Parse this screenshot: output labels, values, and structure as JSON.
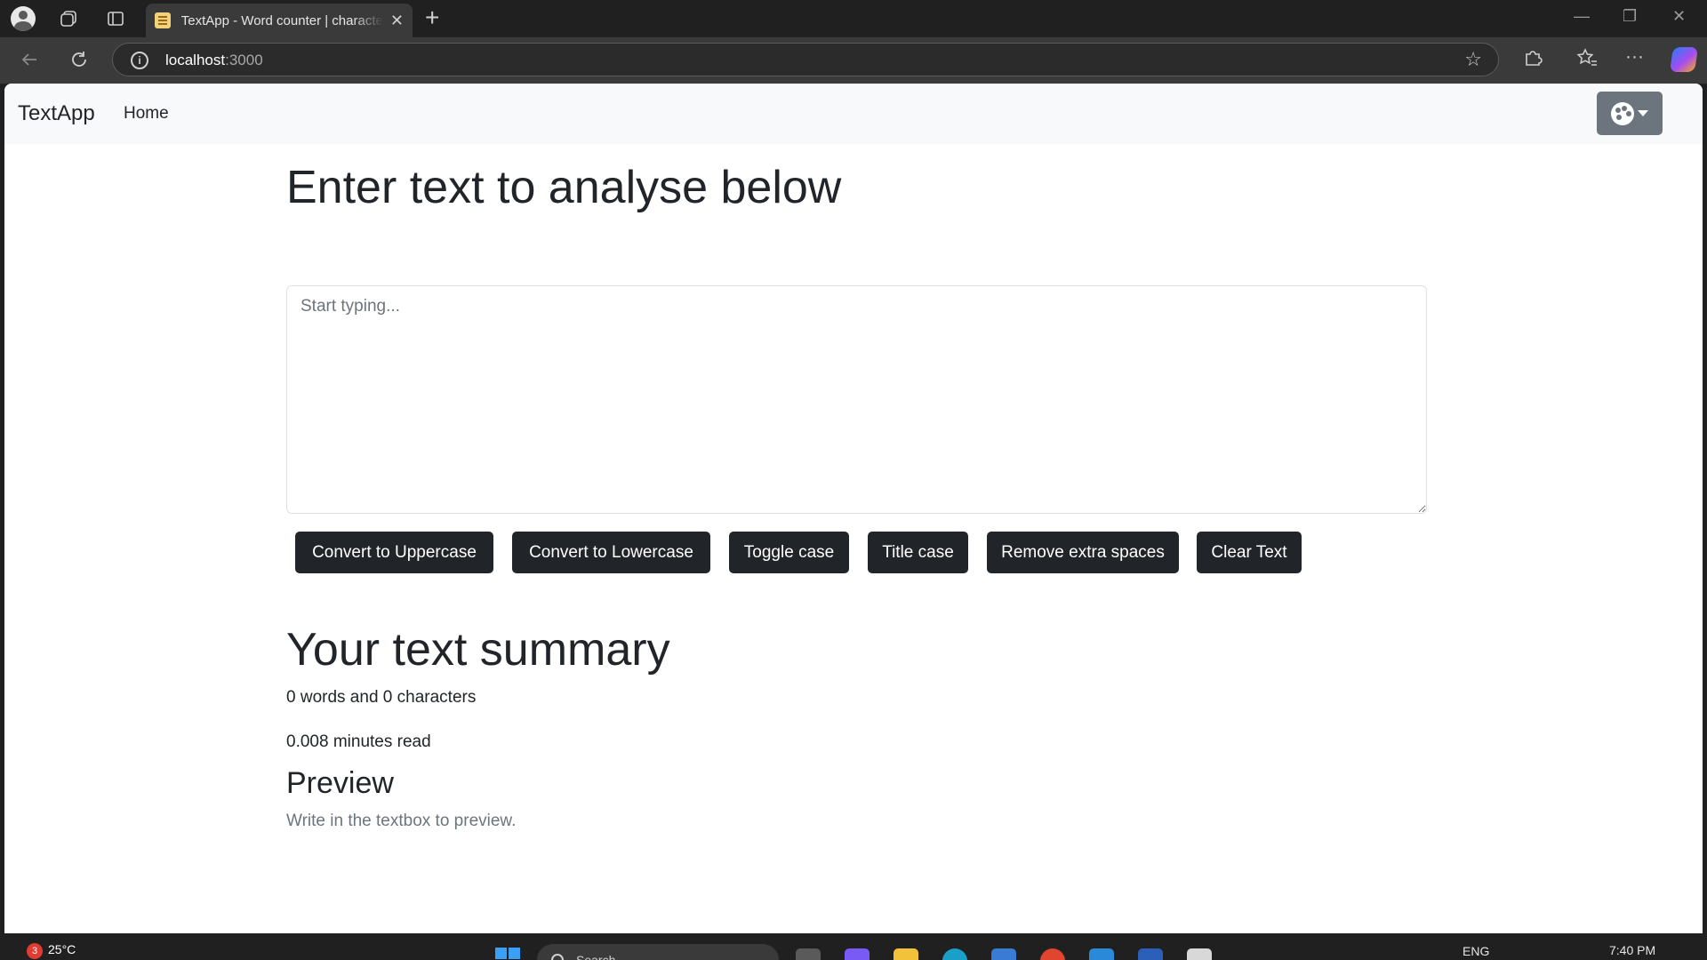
{
  "browser": {
    "tab_title": "TextApp - Word counter | character counter",
    "tab_close": "✕",
    "new_tab": "+",
    "url_host": "localhost",
    "url_port": ":3000",
    "window_minimize": "—",
    "window_restore": "❐",
    "window_close": "✕"
  },
  "navbar": {
    "brand": "TextApp",
    "home_link": "Home"
  },
  "main": {
    "heading": "Enter text to analyse below",
    "textarea_placeholder": "Start typing...",
    "textarea_value": "",
    "buttons": [
      "Convert to Uppercase",
      "Convert to Lowercase",
      "Toggle case",
      "Title case",
      "Remove extra spaces",
      "Clear Text"
    ],
    "summary_heading": "Your text summary",
    "word_char_count": "0 words and 0 characters",
    "read_time": "0.008 minutes read",
    "preview_heading": "Preview",
    "preview_text": "Write in the textbox to preview."
  },
  "taskbar": {
    "weather_badge": "3",
    "temperature": "25°C",
    "search_label": "Search",
    "language": "ENG",
    "time": "7:40 PM"
  },
  "colors": {
    "dark_button": "#212529",
    "theme_button": "#6c757d",
    "navbar_bg": "#f8f9fa",
    "browser_chrome": "#202020"
  },
  "icons": [
    "profile-icon",
    "workspaces-icon",
    "tab-actions-icon",
    "info-icon",
    "favorite-star-icon",
    "extensions-icon",
    "favorites-icon",
    "more-icon",
    "copilot-icon",
    "palette-icon",
    "windows-start-icon",
    "search-icon"
  ]
}
